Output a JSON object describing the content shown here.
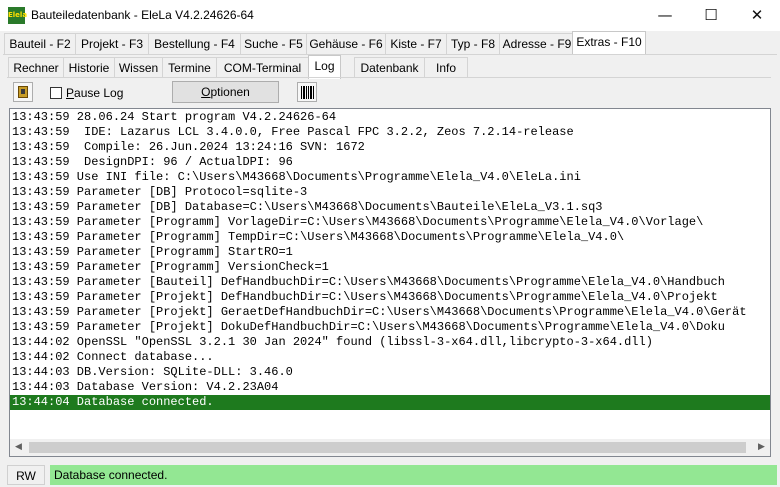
{
  "window": {
    "title": "Bauteiledatenbank - EleLa V4.2.24626-64",
    "icon_text": "Elela",
    "minimize": "—",
    "maximize": "☐",
    "close": "✕"
  },
  "main_tabs": [
    {
      "label": "Bauteil - F2"
    },
    {
      "label": "Projekt - F3"
    },
    {
      "label": "Bestellung - F4"
    },
    {
      "label": "Suche - F5"
    },
    {
      "label": "Gehäuse - F6"
    },
    {
      "label": "Kiste - F7"
    },
    {
      "label": "Typ - F8"
    },
    {
      "label": "Adresse - F9"
    },
    {
      "label": "Extras - F10",
      "active": true
    }
  ],
  "sub_tabs": [
    {
      "label": "Rechner"
    },
    {
      "label": "Historie"
    },
    {
      "label": "Wissen"
    },
    {
      "label": "Termine"
    },
    {
      "label": "COM-Terminal"
    },
    {
      "label": "Log",
      "active": true
    },
    {
      "label": "Datenbank"
    },
    {
      "label": "Info"
    }
  ],
  "toolbar": {
    "pause_log_label": "Pause Log",
    "pause_log_checked": false,
    "options_label": "Optionen"
  },
  "log_lines": [
    "13:43:59 28.06.24 Start program V4.2.24626-64",
    "13:43:59  IDE: Lazarus LCL 3.4.0.0, Free Pascal FPC 3.2.2, Zeos 7.2.14-release",
    "13:43:59  Compile: 26.Jun.2024 13:24:16 SVN: 1672",
    "13:43:59  DesignDPI: 96 / ActualDPI: 96",
    "13:43:59 Use INI file: C:\\Users\\M43668\\Documents\\Programme\\Elela_V4.0\\EleLa.ini",
    "13:43:59 Parameter [DB] Protocol=sqlite-3",
    "13:43:59 Parameter [DB] Database=C:\\Users\\M43668\\Documents\\Bauteile\\EleLa_V3.1.sq3",
    "13:43:59 Parameter [Programm] VorlageDir=C:\\Users\\M43668\\Documents\\Programme\\Elela_V4.0\\Vorlage\\",
    "13:43:59 Parameter [Programm] TempDir=C:\\Users\\M43668\\Documents\\Programme\\Elela_V4.0\\",
    "13:43:59 Parameter [Programm] StartRO=1",
    "13:43:59 Parameter [Programm] VersionCheck=1",
    "13:43:59 Parameter [Bauteil] DefHandbuchDir=C:\\Users\\M43668\\Documents\\Programme\\Elela_V4.0\\Handbuch",
    "13:43:59 Parameter [Projekt] DefHandbuchDir=C:\\Users\\M43668\\Documents\\Programme\\Elela_V4.0\\Projekt",
    "13:43:59 Parameter [Projekt] GeraetDefHandbuchDir=C:\\Users\\M43668\\Documents\\Programme\\Elela_V4.0\\Gerät",
    "13:43:59 Parameter [Projekt] DokuDefHandbuchDir=C:\\Users\\M43668\\Documents\\Programme\\Elela_V4.0\\Doku",
    "13:44:02 OpenSSL \"OpenSSL 3.2.1 30 Jan 2024\" found (libssl-3-x64.dll,libcrypto-3-x64.dll)",
    "13:44:02 Connect database...",
    "13:44:03 DB.Version: SQLite-DLL: 3.46.0",
    "13:44:03 Database Version: V4.2.23A04",
    "13:44:04 Database connected."
  ],
  "highlighted_line_index": 19,
  "statusbar": {
    "mode": "RW",
    "message": "Database connected."
  },
  "colors": {
    "highlight": "#1e7a1e",
    "status_message_bg": "#93e793"
  }
}
